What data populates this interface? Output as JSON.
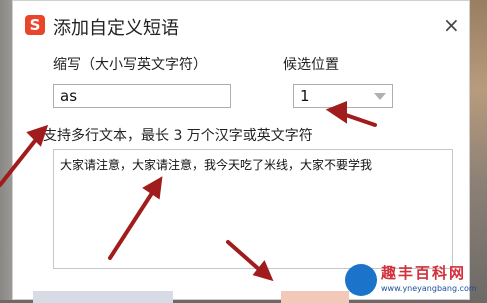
{
  "dialog": {
    "logo_glyph": "S",
    "title": "添加自定义短语",
    "close_glyph": "×"
  },
  "form": {
    "abbr_label": "缩写（大小写英文字符）",
    "abbr_value": "as",
    "position_label": "候选位置",
    "position_value": "1",
    "content_hint": "支持多行文本，最长 3 万个汉字或英文字符",
    "content_text": "大家请注意，大家请注意，我今天吃了米线，大家不要学我"
  },
  "watermark": {
    "brand": "趣丰百科网",
    "url": "www.yneyangbang.com"
  },
  "colors": {
    "arrow": "#a11c1c",
    "logo": "#e8452b"
  }
}
